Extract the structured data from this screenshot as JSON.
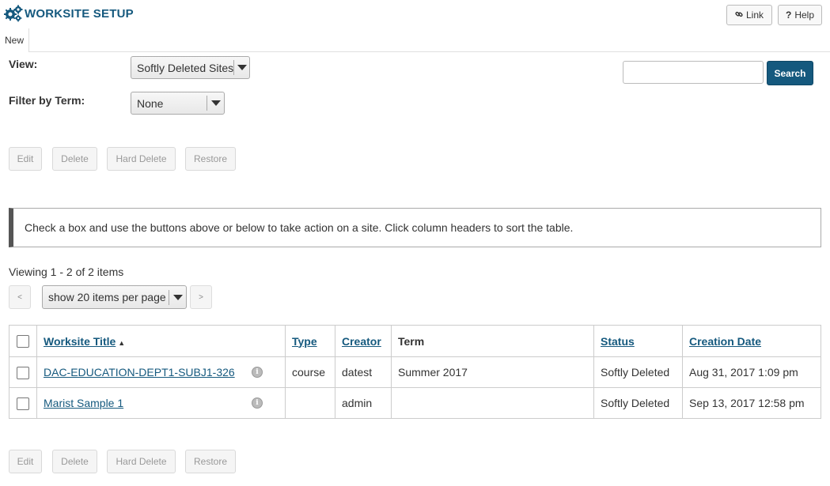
{
  "header": {
    "title": "WORKSITE SETUP",
    "link_label": "Link",
    "help_label": "Help",
    "link_icon": "link-icon",
    "help_icon": "question-icon",
    "gear_icon": "gears-icon"
  },
  "tabs": [
    {
      "label": "New"
    }
  ],
  "filters": {
    "view_label": "View:",
    "view_value": "Softly Deleted Sites",
    "term_label": "Filter by Term:",
    "term_value": "None"
  },
  "search": {
    "value": "",
    "placeholder": "",
    "button_label": "Search"
  },
  "actions": {
    "edit": "Edit",
    "delete": "Delete",
    "hard_delete": "Hard Delete",
    "restore": "Restore"
  },
  "instructions": "Check a box and use the buttons above or below to take action on a site. Click column headers to sort the table.",
  "pager": {
    "viewing_text": "Viewing 1 - 2 of 2 items",
    "prev": "<",
    "next": ">",
    "page_size": "show 20 items per page"
  },
  "table": {
    "headers": {
      "title": "Worksite Title",
      "type": "Type",
      "creator": "Creator",
      "term": "Term",
      "status": "Status",
      "creation_date": "Creation Date"
    },
    "rows": [
      {
        "title": "DAC-EDUCATION-DEPT1-SUBJ1-326",
        "type": "course",
        "creator": "datest",
        "term": "Summer 2017",
        "status": "Softly Deleted",
        "creation_date": "Aug 31, 2017 1:09 pm"
      },
      {
        "title": "Marist Sample 1",
        "type": "",
        "creator": "admin",
        "term": "",
        "status": "Softly Deleted",
        "creation_date": "Sep 13, 2017 12:58 pm"
      }
    ]
  },
  "colors": {
    "brand": "#15597e",
    "disabled_text": "#999999",
    "border": "#cccccc"
  }
}
